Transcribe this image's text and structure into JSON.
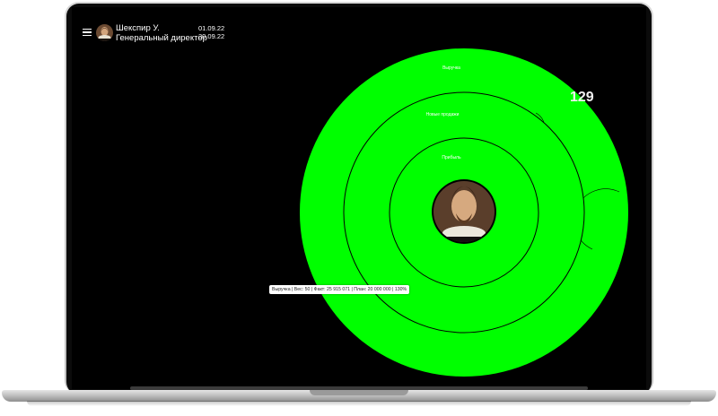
{
  "user": {
    "name": "Шекспир У.",
    "role": "Генеральный директор"
  },
  "period": {
    "start": "01.09.22",
    "end": "30.09.22"
  },
  "rings": [
    {
      "label": "Выручка"
    },
    {
      "label": "Новые продажи"
    },
    {
      "label": "Прибыль"
    }
  ],
  "counter": "129",
  "tooltip": "Выручка | Вес: 50 | Факт: 25 915 071 | План: 20 000 000 | 130%",
  "colors": {
    "screen_bg": "#000000",
    "ring_fill": "#00ff00",
    "ring_stroke": "#000000",
    "text": "#ffffff"
  },
  "icons": {
    "menu": "hamburger-menu-icon",
    "user_avatar": "portrait-avatar",
    "center": "portrait-avatar"
  }
}
